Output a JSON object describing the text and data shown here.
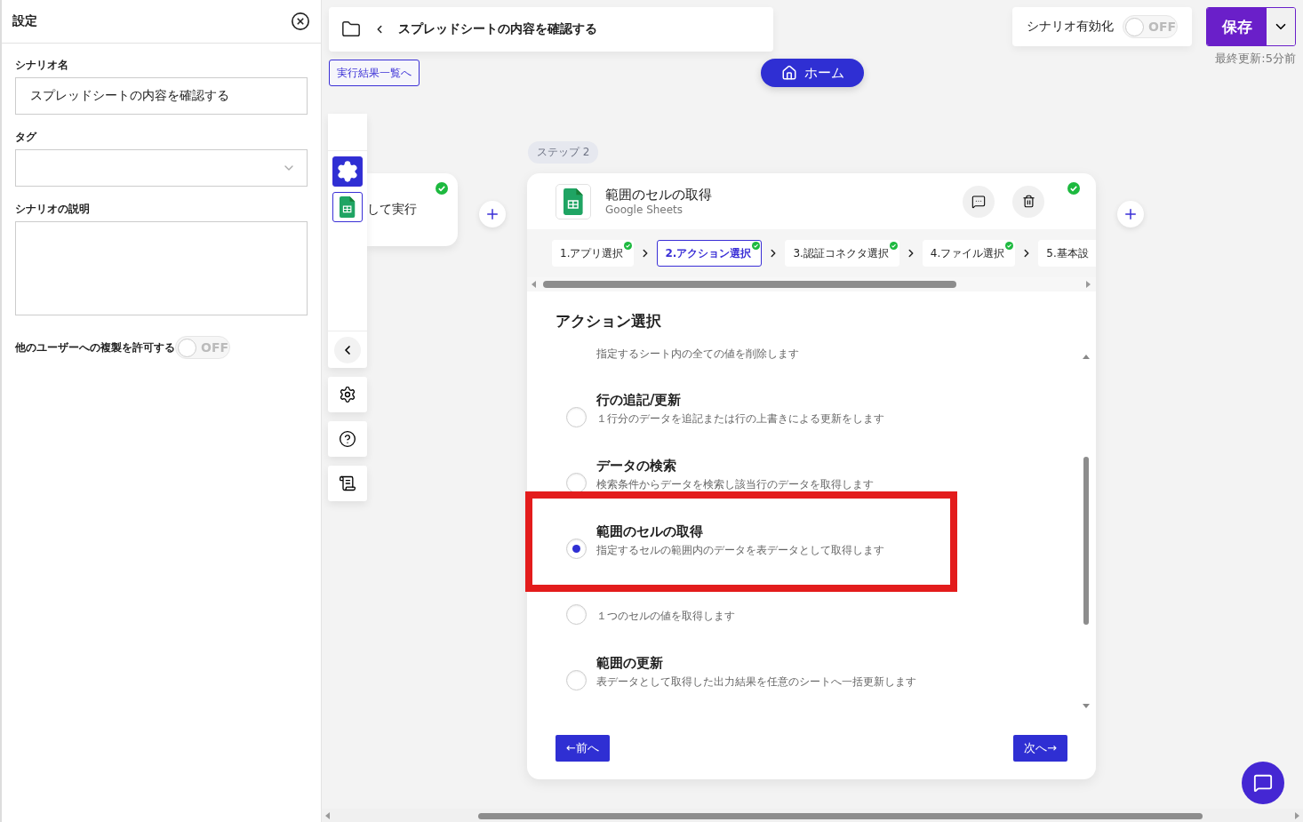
{
  "settings_panel": {
    "title": "設定",
    "fields": [
      {
        "kind": "text",
        "label": "シナリオ名",
        "value": "スプレッドシートの内容を確認する"
      },
      {
        "kind": "select",
        "label": "タグ"
      },
      {
        "kind": "textarea",
        "label": "シナリオの説明"
      }
    ],
    "copy_toggle": {
      "label": "他のユーザーへの複製を許可する",
      "on": false,
      "text": "OFF"
    }
  },
  "breadcrumb": {
    "title": "スプレッドシートの内容を確認する"
  },
  "results_link": "実行結果一覧へ",
  "home_button": "ホーム",
  "scenario_toggle": {
    "label": "シナリオ有効化",
    "on": false,
    "text": "OFF"
  },
  "save_button": "保存",
  "last_updated": "最終更新:5分前",
  "prev_node": {
    "text": "して実行",
    "done": true
  },
  "step_label": "ステップ 2",
  "step_card": {
    "title": "範囲のセルの取得",
    "app": "Google Sheets",
    "done": true,
    "tabs": [
      {
        "label": "1.アプリ選択",
        "selected": false,
        "done": true
      },
      {
        "label": "2.アクション選択",
        "selected": true,
        "done": true
      },
      {
        "label": "3.認証コネクタ選択",
        "selected": false,
        "done": true
      },
      {
        "label": "4.ファイル選択",
        "selected": false,
        "done": true
      },
      {
        "label": "5.基本設",
        "selected": false,
        "done": false
      }
    ],
    "heading": "アクション選択",
    "options": [
      {
        "kind": "partial",
        "description": "指定するシート内の全ての値を削除します"
      },
      {
        "kind": "full",
        "title": "行の追記/更新",
        "description": "１行分のデータを追記または行の上書きによる更新をします",
        "selected": false
      },
      {
        "kind": "full",
        "title": "データの検索",
        "description": "検索条件からデータを検索し該当行のデータを取得します",
        "selected": false
      },
      {
        "kind": "full",
        "title": "範囲のセルの取得",
        "description": "指定するセルの範囲内のデータを表データとして取得します",
        "selected": true
      },
      {
        "kind": "covered",
        "description": "１つのセルの値を取得します",
        "selected": false
      },
      {
        "kind": "full",
        "title": "範囲の更新",
        "description": "表データとして取得した出力結果を任意のシートへ一括更新します",
        "selected": false
      }
    ],
    "prev_button": "←前へ",
    "next_button": "次へ→"
  }
}
